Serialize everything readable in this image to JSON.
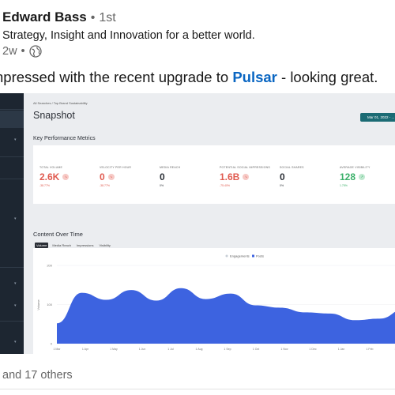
{
  "post": {
    "author": "Edward Bass",
    "separator": "•",
    "degree": "1st",
    "headline": "Strategy, Insight and Innovation for a better world.",
    "time": "2w",
    "meta_separator": "•",
    "visibility_icon": "globe-icon",
    "text_before": "npressed with the recent upgrade to ",
    "link_text": "Pulsar",
    "text_after": " - looking great.",
    "reactions": "and 17 others"
  },
  "dashboard": {
    "breadcrumb": "All Searches / Top Brand Sustainability",
    "title": "Snapshot",
    "date_button": "Mar 01, 2022 - ...",
    "kpi_section": "Key Performance Metrics",
    "kpis": [
      {
        "label": "TOTAL VOLUME",
        "value": "2.6K",
        "change": "-38.77%",
        "color": "#e05a4f",
        "badge": "down"
      },
      {
        "label": "VELOCITY PER HOUR",
        "value": "0",
        "change": "-38.77%",
        "color": "#e05a4f",
        "badge": "down"
      },
      {
        "label": "MEDIA REACH",
        "value": "0",
        "change": "0%",
        "color": "#2b2f36",
        "badge": "none"
      },
      {
        "label": "POTENTIAL SOCIAL IMPRESSIONS",
        "value": "1.6B",
        "change": "-75.40%",
        "color": "#e05a4f",
        "badge": "down"
      },
      {
        "label": "SOCIAL SHARES",
        "value": "0",
        "change": "0%",
        "color": "#2b2f36",
        "badge": "none"
      },
      {
        "label": "AVERAGE VISIBILITY",
        "value": "128",
        "change": "1.75%",
        "color": "#3bb06a",
        "badge": "up"
      }
    ],
    "content_title": "Content Over Time",
    "tabs": [
      "Volume",
      "Media Reach",
      "Impressions",
      "Visibility"
    ],
    "legend": [
      "Engagements",
      "Posts"
    ],
    "colors": {
      "posts": "#3d63e0",
      "engagements": "#c7cdd6",
      "sidebar": "#1d2631",
      "accent": "#1b6b74"
    }
  },
  "chart_data": {
    "type": "area",
    "ylabel": "Volume",
    "y_ticks": [
      "200",
      "100",
      "0"
    ],
    "ylim": [
      0,
      200
    ],
    "x_labels": [
      "1 Mar",
      "1 Apr",
      "1 May",
      "1 Jun",
      "1 Jul",
      "1 Aug",
      "1 Sep",
      "1 Oct",
      "1 Nov",
      "1 Dec",
      "1 Jan",
      "1 Feb",
      "1 Mar"
    ],
    "series": [
      {
        "name": "Posts",
        "values": [
          52,
          130,
          112,
          137,
          110,
          142,
          114,
          128,
          98,
          92,
          80,
          77,
          60,
          64,
          88
        ]
      }
    ]
  }
}
